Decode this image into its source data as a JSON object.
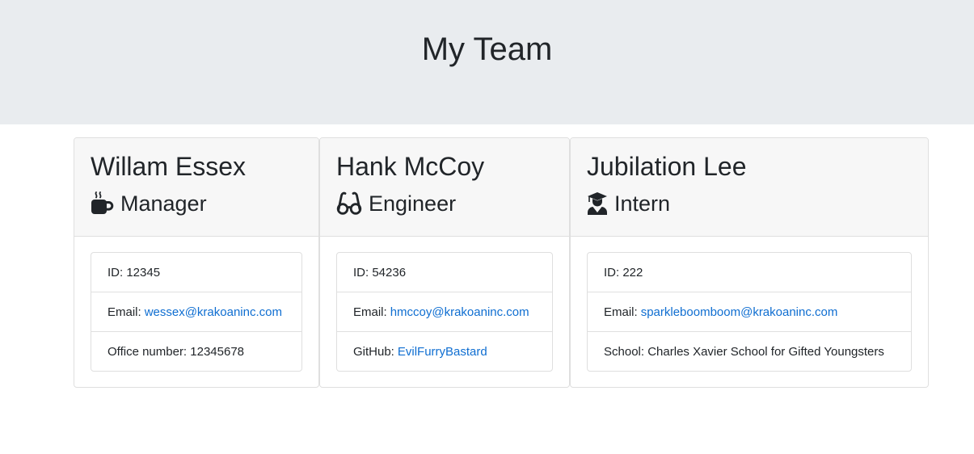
{
  "header": {
    "title": "My Team"
  },
  "colors": {
    "jumbotron_bg": "#e9ecef",
    "link": "#0f6ed1",
    "card_header_bg": "#f7f7f7"
  },
  "cards": [
    {
      "name": "Willam Essex",
      "role": "Manager",
      "role_icon": "coffee-mug-icon",
      "id_label": "ID:",
      "id": "12345",
      "email_label": "Email:",
      "email": "wessex@krakoaninc.com",
      "extra_label": "Office number:",
      "extra_value": "12345678"
    },
    {
      "name": "Hank McCoy",
      "role": "Engineer",
      "role_icon": "glasses-icon",
      "id_label": "ID:",
      "id": "54236",
      "email_label": "Email:",
      "email": "hmccoy@krakoaninc.com",
      "extra_label": "GitHub:",
      "extra_value": "EvilFurryBastard"
    },
    {
      "name": "Jubilation Lee",
      "role": "Intern",
      "role_icon": "graduate-icon",
      "id_label": "ID:",
      "id": "222",
      "email_label": "Email:",
      "email": "sparkleboomboom@krakoaninc.com",
      "extra_label": "School:",
      "extra_value": "Charles Xavier School for Gifted Youngsters"
    }
  ]
}
